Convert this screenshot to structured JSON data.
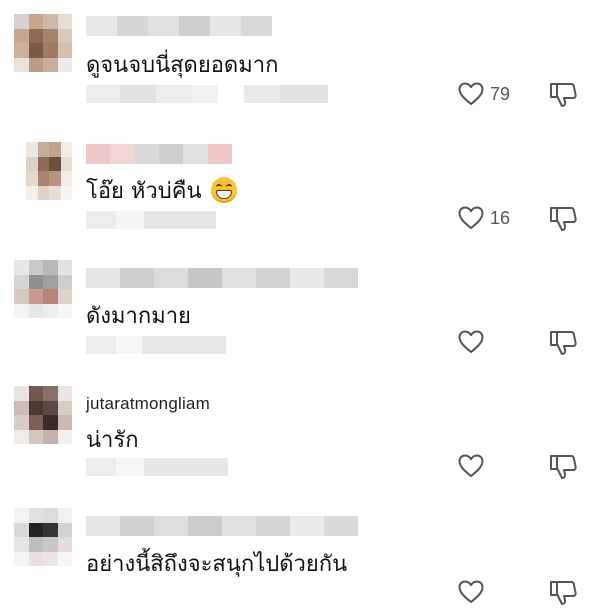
{
  "comments": [
    {
      "username": "",
      "text": "ดูจนจบนี่สุดยอดมาก",
      "likes": "79",
      "has_emoji": false
    },
    {
      "username": "",
      "text": "โอ๊ย หัวบ่คืน",
      "likes": "16",
      "has_emoji": true,
      "emoji": "grinning-face-emoji"
    },
    {
      "username": "",
      "text": "ดังมากมาย",
      "likes": "",
      "has_emoji": false
    },
    {
      "username": "jutaratmongliam",
      "text": "น่ารัก",
      "likes": "",
      "has_emoji": false
    },
    {
      "username": "",
      "text": "อย่างนี้สิถึงจะสนุกไปด้วยกัน",
      "likes": "",
      "has_emoji": false
    }
  ],
  "icons": {
    "like": "heart-outline-icon",
    "dislike": "thumbs-down-outline-icon"
  },
  "colors": {
    "icon": "#555555",
    "text": "#111111",
    "blur": "#e6e6e6"
  }
}
